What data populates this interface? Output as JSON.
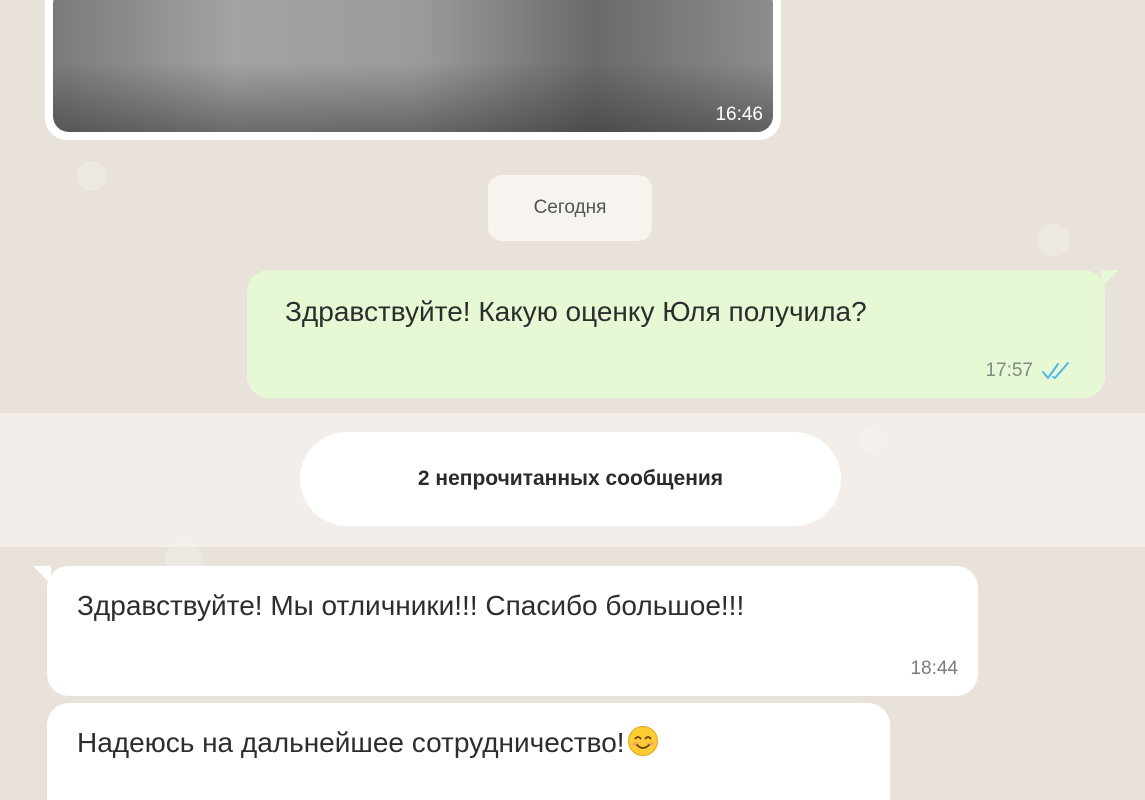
{
  "colors": {
    "chat_background": "#e9e2da",
    "outgoing_bubble": "#e7f9d4",
    "incoming_bubble": "#ffffff",
    "read_checks": "#4fb6ec"
  },
  "media_message": {
    "time": "16:46"
  },
  "date_separator": {
    "label": "Сегодня"
  },
  "outgoing_message": {
    "text": "Здравствуйте! Какую оценку Юля получила?",
    "time": "17:57",
    "status_icon": "double-check-read-icon"
  },
  "unread_separator": {
    "label": "2 непрочитанных сообщения"
  },
  "incoming_messages": [
    {
      "text": "Здравствуйте! Мы отличники!!! Спасибо большое!!!",
      "time": "18:44"
    },
    {
      "text": "Надеюсь на дальнейшее сотрудничество!",
      "emoji_icon": "smiling-face-icon"
    }
  ]
}
